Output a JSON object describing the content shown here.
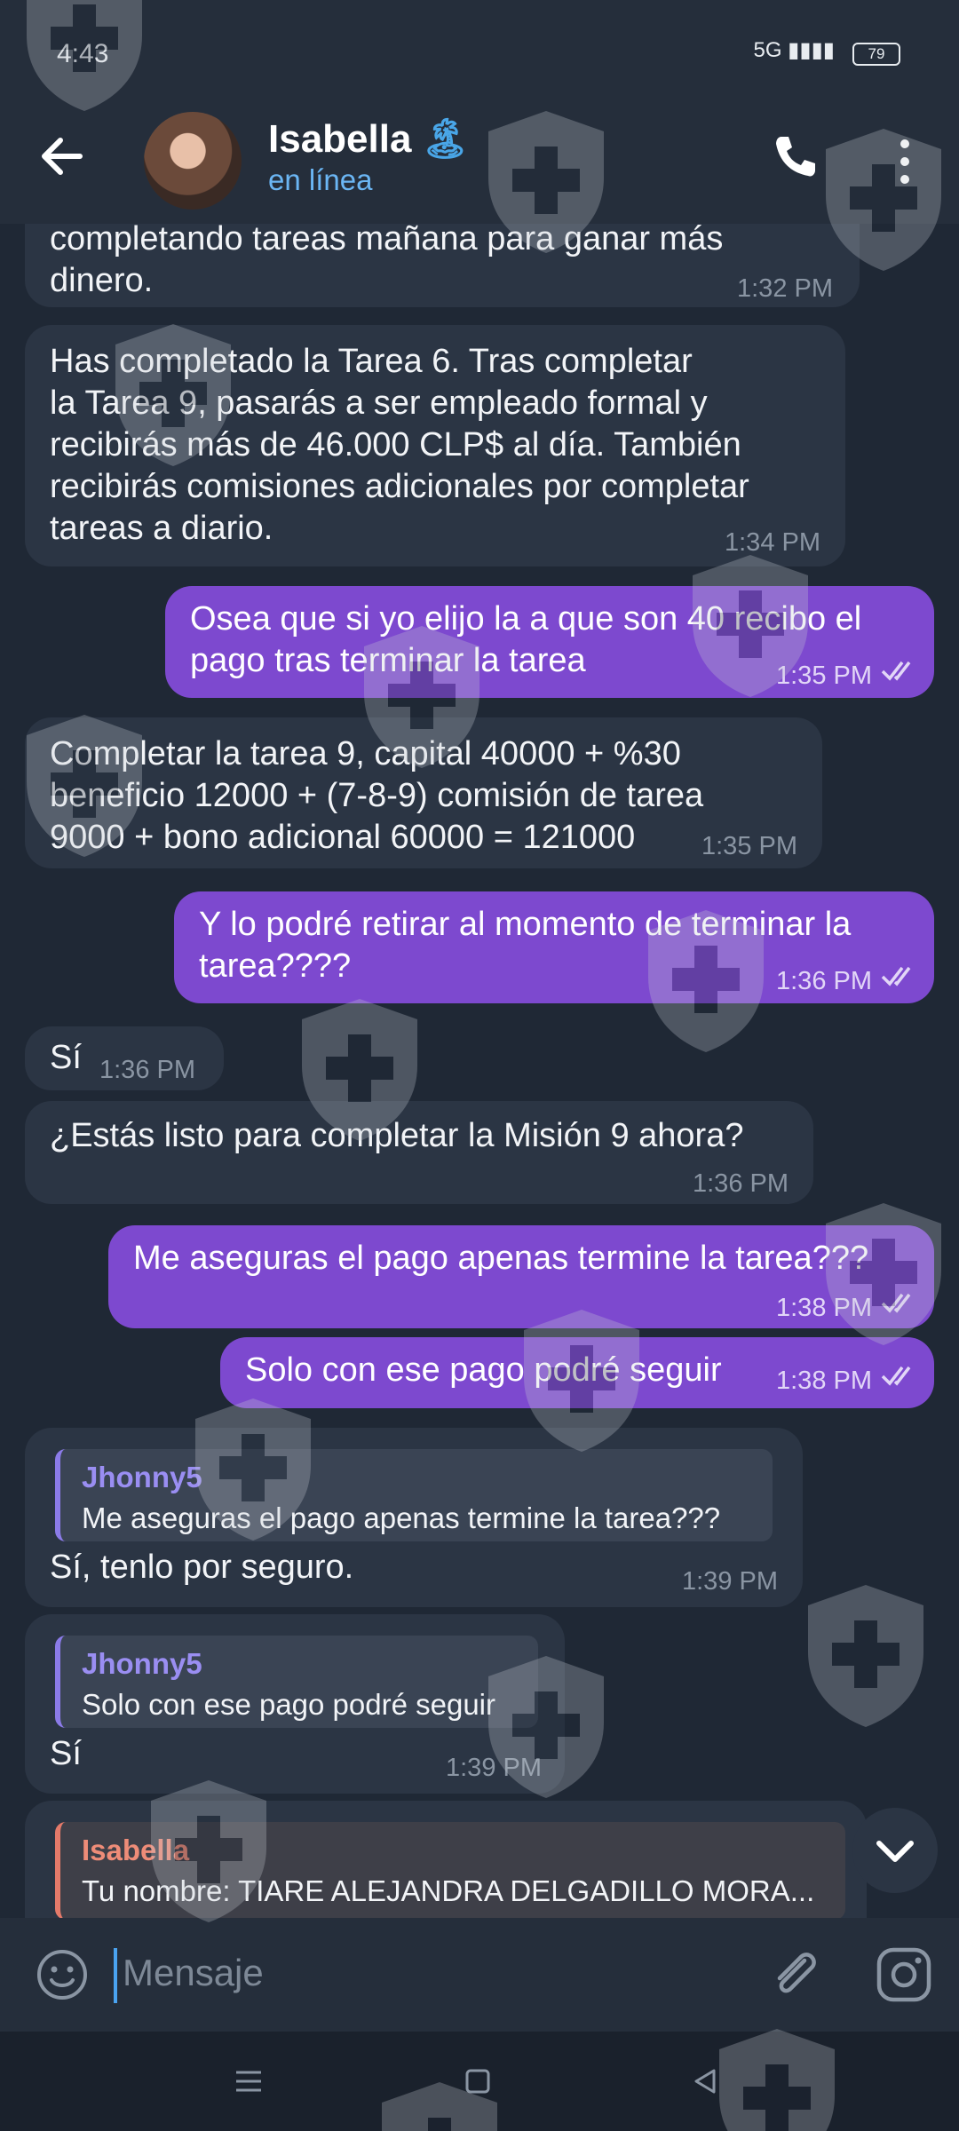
{
  "status_bar": {
    "time": "4:43",
    "signal": "5G",
    "battery": "79"
  },
  "header": {
    "name": "Isabella",
    "name_emoji": "🏝",
    "status": "en línea"
  },
  "messages": [
    {
      "text": "completando tareas mañana para ganar más\ndinero.",
      "time": "1:32 PM"
    },
    {
      "text": "Has completado la Tarea 6. Tras completar\nla Tarea 9, pasarás a ser empleado formal y\nrecibirás más de 46.000 CLP$ al día. También\nrecibirás comisiones adicionales por completar\ntareas a diario.",
      "time": "1:34 PM"
    },
    {
      "text": "Osea que si yo elijo la a que son 40 recibo el\npago tras terminar la tarea",
      "time": "1:35 PM"
    },
    {
      "text": "Completar la tarea 9, capital 40000 + %30\nbeneficio 12000 + (7-8-9) comisión de tarea\n9000 + bono adicional 60000 = 121000",
      "time": "1:35 PM"
    },
    {
      "text": "Y lo podré retirar al momento de terminar la\ntarea????",
      "time": "1:36 PM"
    },
    {
      "text": "Sí",
      "time": "1:36 PM"
    },
    {
      "text": "¿Estás listo para completar la Misión 9 ahora?",
      "time": "1:36 PM"
    },
    {
      "text": "Me aseguras el pago apenas termine la tarea???",
      "time": "1:38 PM"
    },
    {
      "text": "Solo con ese pago podré seguir",
      "time": "1:38 PM"
    },
    {
      "reply_name": "Jhonny5",
      "reply_text": "Me aseguras el pago apenas termine la tarea???",
      "text": "Sí, tenlo por seguro.",
      "time": "1:39 PM"
    },
    {
      "reply_name": "Jhonny5",
      "reply_text": "Solo con ese pago podré seguir",
      "text": "Sí",
      "time": "1:39 PM"
    },
    {
      "reply_name": "Isabella",
      "reply_text": "Tu nombre: TIARE ALEJANDRA DELGADILLO MORA..."
    }
  ],
  "input": {
    "placeholder": "Mensaje"
  },
  "icons": {
    "back": "arrow-left-icon",
    "call": "phone-icon",
    "menu": "more-vert-icon",
    "emoji": "smiley-icon",
    "attach": "paperclip-icon",
    "camera": "instagram-camera-icon",
    "scroll": "chevron-down-icon",
    "read": "double-check-icon",
    "watermark": "shield-cross-icon"
  },
  "colors": {
    "outgoing": "#7d49cf",
    "incoming": "#2b3544",
    "accent": "#6bb6f4",
    "reply_accent": "#8b7be8"
  }
}
